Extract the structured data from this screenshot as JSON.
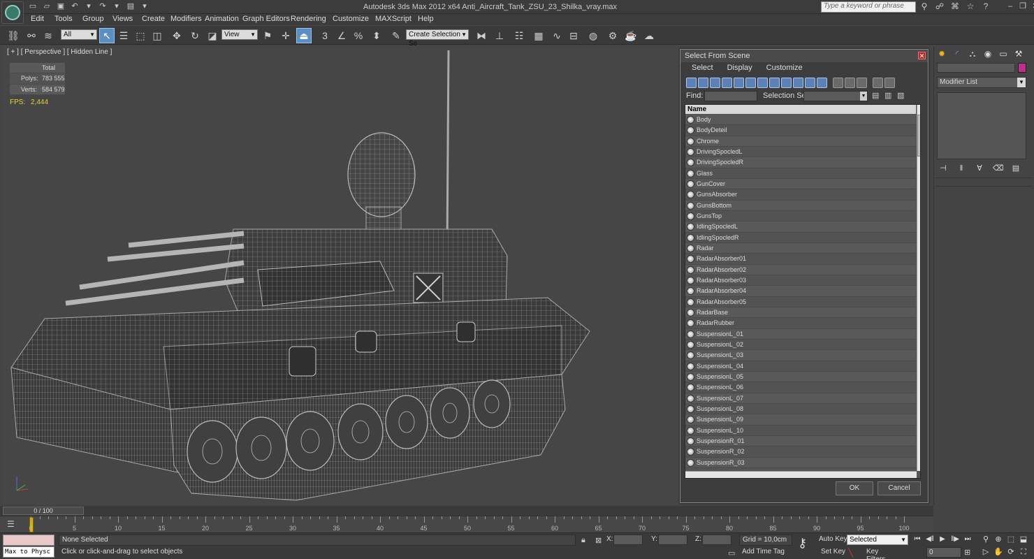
{
  "window": {
    "title": "Autodesk 3ds Max  2012 x64      Anti_Aircraft_Tank_ZSU_23_Shilka_vray.max",
    "search_placeholder": "Type a keyword or phrase"
  },
  "menu": [
    "Edit",
    "Tools",
    "Group",
    "Views",
    "Create",
    "Modifiers",
    "Animation",
    "Graph Editors",
    "Rendering",
    "Customize",
    "MAXScript",
    "Help"
  ],
  "toolbar": {
    "selection_filter": "All",
    "reference_coord": "View",
    "named_selection_placeholder": "Create Selection Se",
    "snap_3": "3",
    "angle_snap": "∠",
    "percent_snap": "%"
  },
  "viewport": {
    "label": "[ + ] [ Perspective ] [ Hidden Line ]",
    "stats": {
      "header": "Total",
      "polys_label": "Polys:",
      "polys": "783 555",
      "verts_label": "Verts:",
      "verts": "584 579",
      "fps_label": "FPS:",
      "fps": "2,444"
    }
  },
  "dialog": {
    "title": "Select From Scene",
    "menu": [
      "Select",
      "Display",
      "Customize"
    ],
    "find_label": "Find:",
    "selection_set_label": "Selection Set:",
    "column_name": "Name",
    "items": [
      "Body",
      "BodyDeteil",
      "Chrome",
      "DrivingSpocledL",
      "DrivingSpocledR",
      "Glass",
      "GunCover",
      "GunsAbsorber",
      "GunsBottom",
      "GunsTop",
      "IdlingSpocledL",
      "IdlingSpocledR",
      "Radar",
      "RadarAbsorber01",
      "RadarAbsorber02",
      "RadarAbsorber03",
      "RadarAbsorber04",
      "RadarAbsorber05",
      "RadarBase",
      "RadarRubber",
      "SuspensionL_01",
      "SuspensionL_02",
      "SuspensionL_03",
      "SuspensionL_04",
      "SuspensionL_05",
      "SuspensionL_06",
      "SuspensionL_07",
      "SuspensionL_08",
      "SuspensionL_09",
      "SuspensionL_10",
      "SuspensionR_01",
      "SuspensionR_02",
      "SuspensionR_03"
    ],
    "ok": "OK",
    "cancel": "Cancel"
  },
  "command_panel": {
    "modifier_list": "Modifier List"
  },
  "timeline": {
    "slider": "0 / 100",
    "ticks": [
      "0",
      "5",
      "10",
      "15",
      "20",
      "25",
      "30",
      "35",
      "40",
      "45",
      "50",
      "55",
      "60",
      "65",
      "70",
      "75",
      "80",
      "85",
      "90",
      "95",
      "100"
    ]
  },
  "status": {
    "maxscript_output": "Max to Physc",
    "selection": "None Selected",
    "prompt": "Click or click-and-drag to select objects",
    "x_label": "X:",
    "y_label": "Y:",
    "z_label": "Z:",
    "grid": "Grid = 10,0cm",
    "add_time_tag": "Add Time Tag",
    "auto_key": "Auto Key",
    "set_key": "Set Key",
    "key_mode": "Selected",
    "key_filters": "Key Filters...",
    "current_frame": "0"
  },
  "colors": {
    "accent": "#5b8fc4",
    "stats_text": "#e6d23a",
    "object_color": "#c0308a"
  }
}
